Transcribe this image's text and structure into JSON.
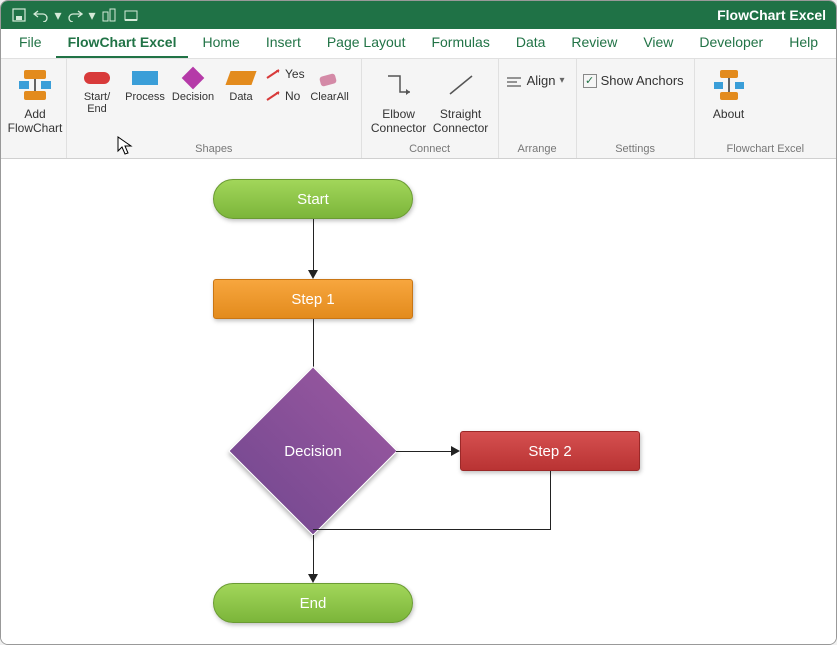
{
  "title": "FlowChart Excel",
  "tabs": [
    "File",
    "FlowChart Excel",
    "Home",
    "Insert",
    "Page Layout",
    "Formulas",
    "Data",
    "Review",
    "View",
    "Developer",
    "Help"
  ],
  "active_tab": "FlowChart Excel",
  "ribbon": {
    "add_group": {
      "add": "Add FlowChart"
    },
    "shapes_group": {
      "label": "Shapes",
      "start_end": "Start/\nEnd",
      "process": "Process",
      "decision": "Decision",
      "data": "Data",
      "yes": "Yes",
      "no": "No",
      "clear": "ClearAll"
    },
    "connect_group": {
      "label": "Connect",
      "elbow": "Elbow Connector",
      "straight": "Straight Connector"
    },
    "arrange_group": {
      "label": "Arrange",
      "align": "Align"
    },
    "settings_group": {
      "label": "Settings",
      "show_anchors": "Show Anchors"
    },
    "about_group": {
      "label": "Flowchart Excel",
      "about": "About"
    }
  },
  "flowchart": {
    "start": "Start",
    "step1": "Step 1",
    "decision": "Decision",
    "step2": "Step 2",
    "end": "End"
  }
}
